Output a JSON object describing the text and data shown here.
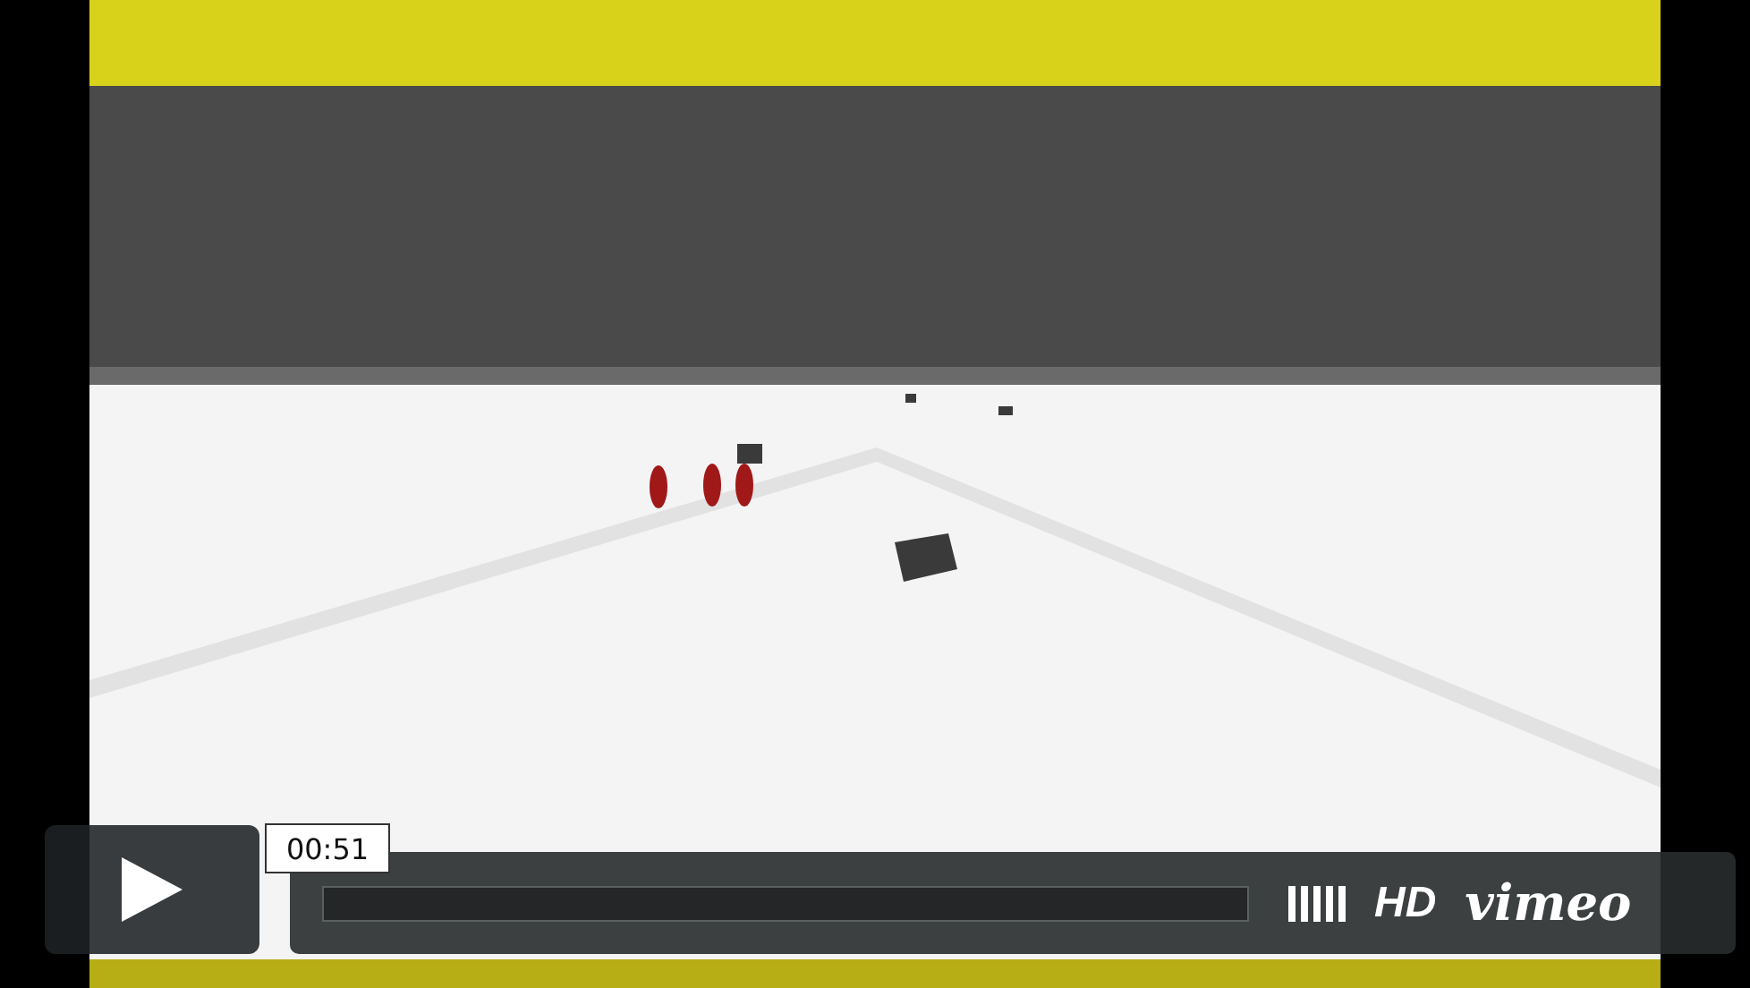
{
  "player": {
    "time": "00:51",
    "progress": {
      "level": 0
    },
    "hd_label": "HD",
    "brand": "vimeo"
  }
}
